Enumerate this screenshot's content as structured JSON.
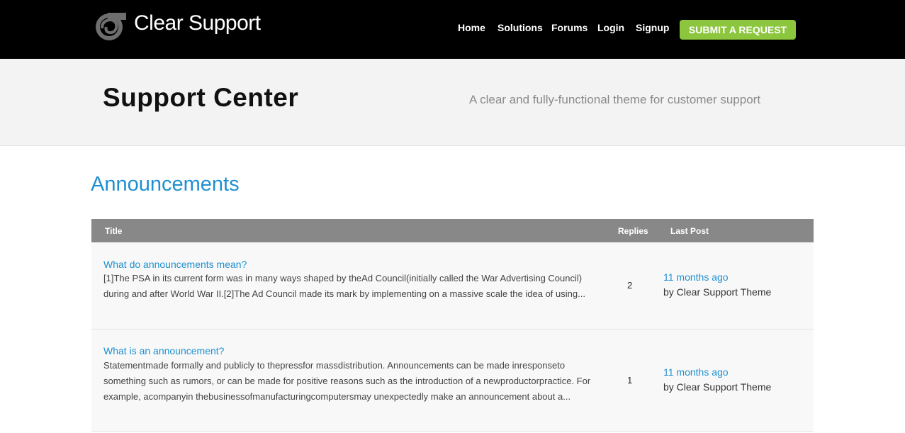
{
  "header": {
    "brand": "Clear Support",
    "logo_icon": "swirl-logo-icon",
    "nav": [
      "Home",
      "Solutions",
      "Forums",
      "Login",
      "Signup"
    ],
    "cta_label": "SUBMIT A REQUEST",
    "cta_color": "#8cc63f"
  },
  "hero": {
    "title": "Support Center",
    "subtitle": "A clear and fully-functional theme for customer support"
  },
  "section": {
    "title": "Announcements",
    "accent": "#1e90d0"
  },
  "table": {
    "columns": [
      "Title",
      "Replies",
      "Last Post"
    ],
    "rows": [
      {
        "title": "What do announcements mean?",
        "excerpt": "[1]The PSA in its current form was in many ways shaped by theAd Council(initially called the War Advertising Council) during and after World War II.[2]The Ad Council made its mark by implementing on a massive scale the idea of using...",
        "replies": "2",
        "last_post_time": "11 months ago",
        "last_post_by": "by Clear Support Theme"
      },
      {
        "title": "What is an announcement?",
        "excerpt": "Statementmade formally and publicly to thepressfor massdistribution. Announcements can be made inresponseto something such as rumors, or can be made for positive reasons such as the introduction of a newproductorpractice. For example, acompanyin thebusinessofmanufacturingcomputersmay unexpectedly make an announcement about a...",
        "replies": "1",
        "last_post_time": "11 months ago",
        "last_post_by": "by Clear Support Theme"
      }
    ]
  }
}
